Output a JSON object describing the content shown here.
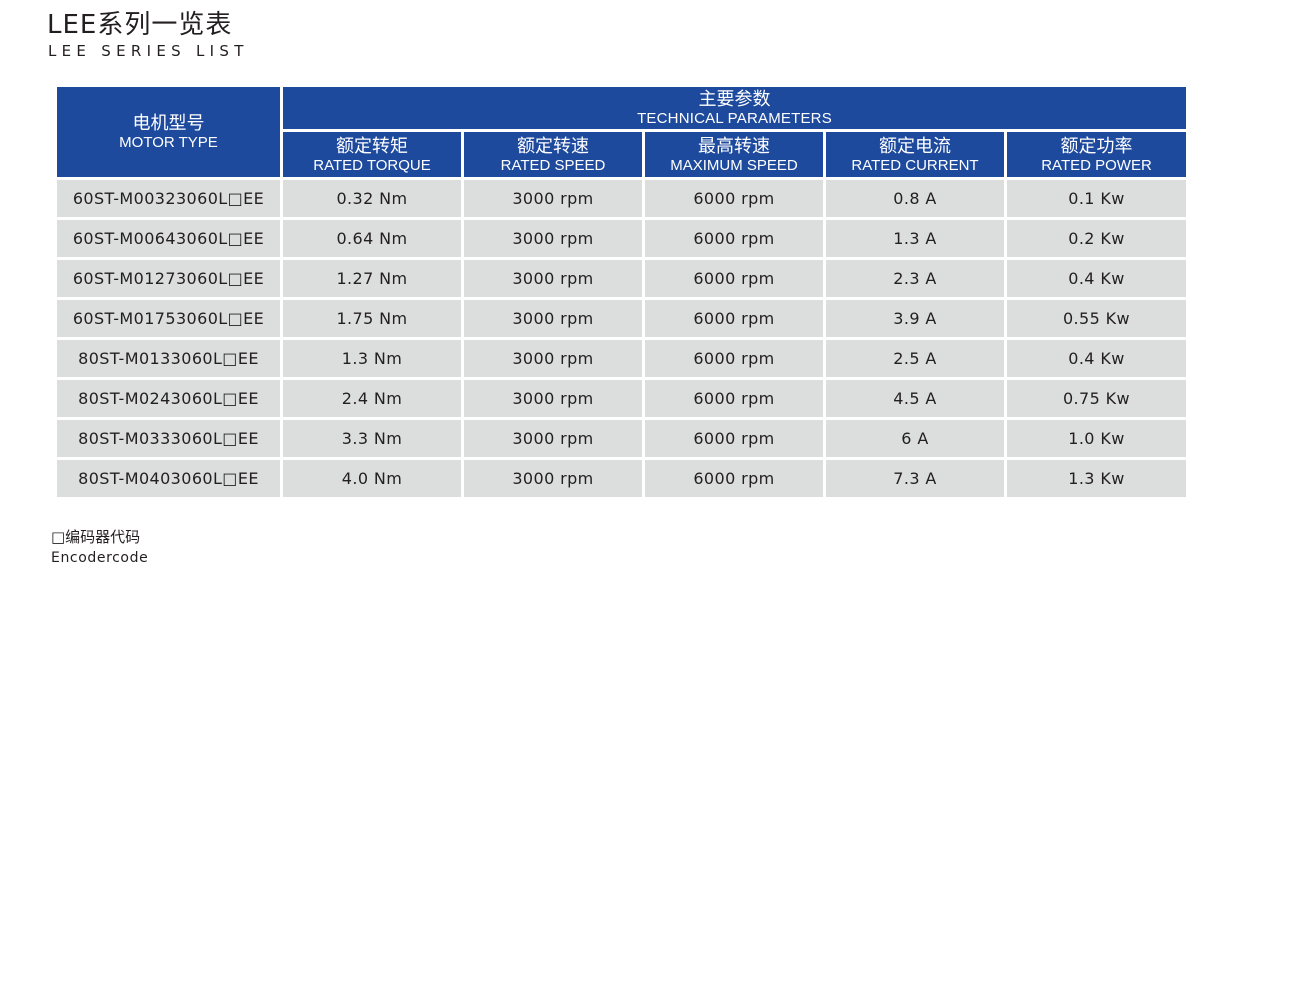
{
  "header": {
    "title_zh": "LEE系列一览表",
    "title_en": "LEE SERIES LIST"
  },
  "table": {
    "model_header": {
      "zh": "电机型号",
      "en": "MOTOR TYPE"
    },
    "group_header": {
      "zh": "主要参数",
      "en": "TECHNICAL PARAMETERS"
    },
    "param_headers": [
      {
        "zh": "额定转矩",
        "en": "RATED TORQUE"
      },
      {
        "zh": "额定转速",
        "en": "RATED SPEED"
      },
      {
        "zh": "最高转速",
        "en": "MAXIMUM SPEED"
      },
      {
        "zh": "额定电流",
        "en": "RATED CURRENT"
      },
      {
        "zh": "额定功率",
        "en": "RATED POWER"
      }
    ],
    "rows": [
      [
        "60ST-M00323060L□EE",
        "0.32 Nm",
        "3000 rpm",
        "6000 rpm",
        "0.8 A",
        "0.1 Kw"
      ],
      [
        "60ST-M00643060L□EE",
        "0.64 Nm",
        "3000 rpm",
        "6000 rpm",
        "1.3 A",
        "0.2 Kw"
      ],
      [
        "60ST-M01273060L□EE",
        "1.27 Nm",
        "3000 rpm",
        "6000 rpm",
        "2.3 A",
        "0.4 Kw"
      ],
      [
        "60ST-M01753060L□EE",
        "1.75 Nm",
        "3000 rpm",
        "6000 rpm",
        "3.9 A",
        "0.55 Kw"
      ],
      [
        "80ST-M0133060L□EE",
        "1.3 Nm",
        "3000 rpm",
        "6000 rpm",
        "2.5 A",
        "0.4 Kw"
      ],
      [
        "80ST-M0243060L□EE",
        "2.4 Nm",
        "3000 rpm",
        "6000 rpm",
        "4.5 A",
        "0.75 Kw"
      ],
      [
        "80ST-M0333060L□EE",
        "3.3 Nm",
        "3000 rpm",
        "6000 rpm",
        "6 A",
        "1.0 Kw"
      ],
      [
        "80ST-M0403060L□EE",
        "4.0 Nm",
        "3000 rpm",
        "6000 rpm",
        "7.3 A",
        "1.3 Kw"
      ]
    ]
  },
  "note": {
    "zh": "□编码器代码",
    "en": "Encodercode"
  },
  "colors": {
    "header_bg": "#1e4a9e",
    "header_text": "#ffffff",
    "cell_bg": "#dcdddd",
    "text": "#231f20"
  }
}
